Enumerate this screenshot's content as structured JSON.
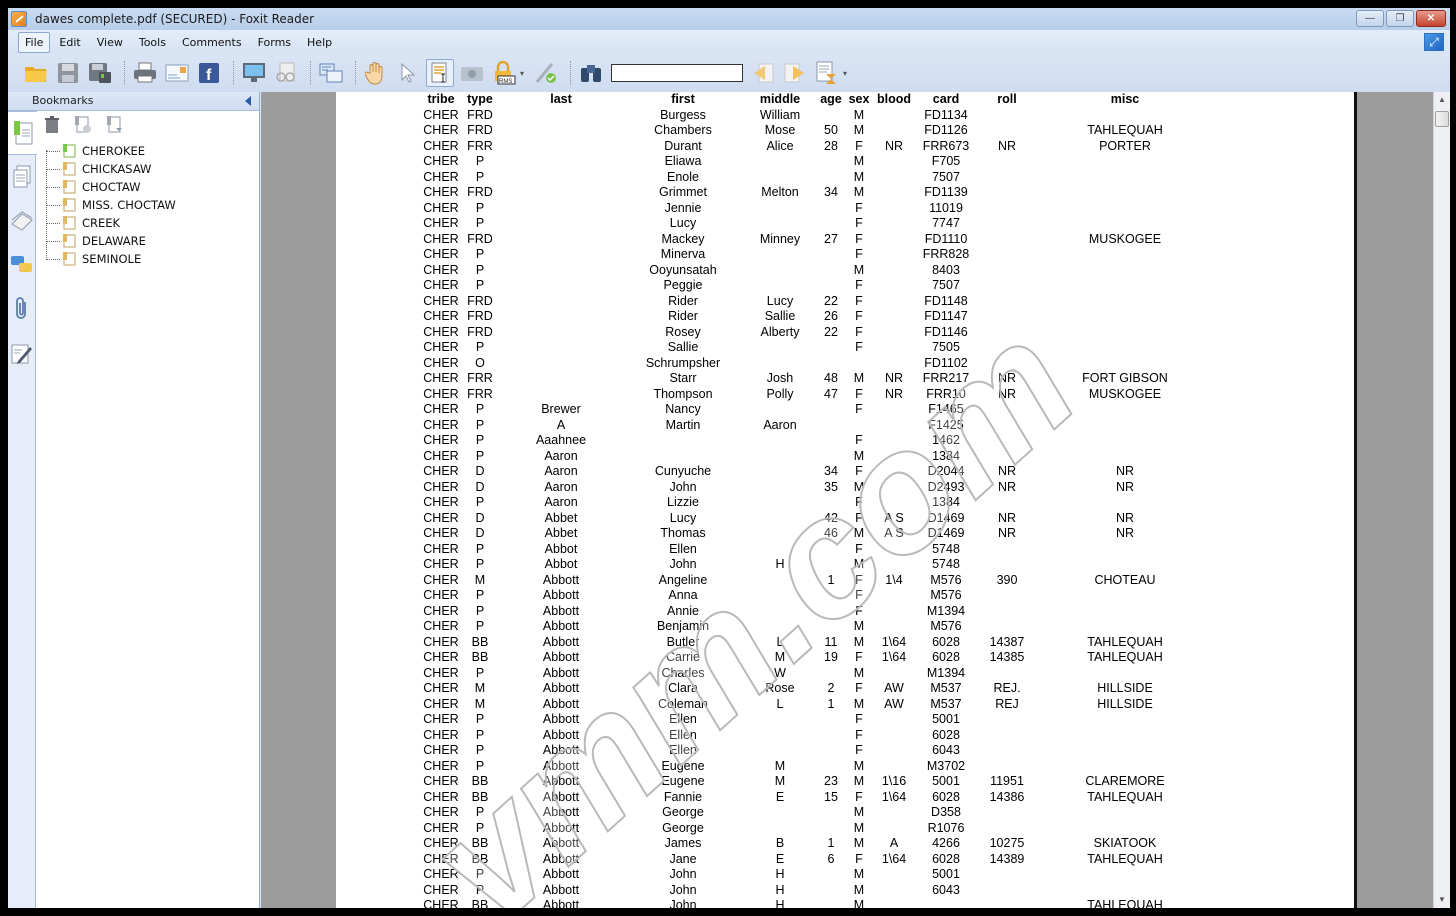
{
  "window": {
    "title": "dawes complete.pdf (SECURED) - Foxit Reader",
    "controls": {
      "minimize": "—",
      "restore": "❐",
      "close": "✕"
    }
  },
  "menu": [
    {
      "label": "File",
      "active": true
    },
    {
      "label": "Edit"
    },
    {
      "label": "View"
    },
    {
      "label": "Tools"
    },
    {
      "label": "Comments"
    },
    {
      "label": "Forms"
    },
    {
      "label": "Help"
    }
  ],
  "toolbar": {
    "icons": [
      "open-folder-icon",
      "save-icon",
      "save-as-icon",
      "print-icon",
      "email-icon",
      "facebook-icon",
      "presentation-icon",
      "reading-glasses-icon",
      "convert-icon",
      "hand-tool-icon",
      "select-arrow-icon",
      "select-text-icon",
      "snapshot-icon",
      "rms-lock-icon",
      "sign-icon",
      "find-binoculars-icon"
    ],
    "find_value": "",
    "find_prev_icon": "find-previous-icon",
    "find_next_icon": "find-next-icon",
    "filter_icon": "search-filter-icon"
  },
  "bookmarks": {
    "title": "Bookmarks",
    "items": [
      {
        "label": "CHEROKEE",
        "active": true
      },
      {
        "label": "CHICKASAW"
      },
      {
        "label": "CHOCTAW"
      },
      {
        "label": "MISS. CHOCTAW"
      },
      {
        "label": "CREEK"
      },
      {
        "label": "DELAWARE"
      },
      {
        "label": "SEMINOLE"
      }
    ]
  },
  "document": {
    "columns": [
      "tribe",
      "type",
      "last",
      "first",
      "middle",
      "age",
      "sex",
      "blood",
      "card",
      "roll",
      "misc"
    ],
    "rows": [
      [
        "CHER",
        "FRD",
        "",
        "Burgess",
        "William",
        "",
        "M",
        "",
        "FD1134",
        "",
        ""
      ],
      [
        "CHER",
        "FRD",
        "",
        "Chambers",
        "Mose",
        "50",
        "M",
        "",
        "FD1126",
        "",
        "TAHLEQUAH"
      ],
      [
        "CHER",
        "FRR",
        "",
        "Durant",
        "Alice",
        "28",
        "F",
        "NR",
        "FRR673",
        "NR",
        "PORTER"
      ],
      [
        "CHER",
        "P",
        "",
        "Eliawa",
        "",
        "",
        "M",
        "",
        "F705",
        "",
        ""
      ],
      [
        "CHER",
        "P",
        "",
        "Enole",
        "",
        "",
        "M",
        "",
        "7507",
        "",
        ""
      ],
      [
        "CHER",
        "FRD",
        "",
        "Grimmet",
        "Melton",
        "34",
        "M",
        "",
        "FD1139",
        "",
        ""
      ],
      [
        "CHER",
        "P",
        "",
        "Jennie",
        "",
        "",
        "F",
        "",
        "11019",
        "",
        ""
      ],
      [
        "CHER",
        "P",
        "",
        "Lucy",
        "",
        "",
        "F",
        "",
        "7747",
        "",
        ""
      ],
      [
        "CHER",
        "FRD",
        "",
        "Mackey",
        "Minney",
        "27",
        "F",
        "",
        "FD1110",
        "",
        "MUSKOGEE"
      ],
      [
        "CHER",
        "P",
        "",
        "Minerva",
        "",
        "",
        "F",
        "",
        "FRR828",
        "",
        ""
      ],
      [
        "CHER",
        "P",
        "",
        "Ooyunsatah",
        "",
        "",
        "M",
        "",
        "8403",
        "",
        ""
      ],
      [
        "CHER",
        "P",
        "",
        "Peggie",
        "",
        "",
        "F",
        "",
        "7507",
        "",
        ""
      ],
      [
        "CHER",
        "FRD",
        "",
        "Rider",
        "Lucy",
        "22",
        "F",
        "",
        "FD1148",
        "",
        ""
      ],
      [
        "CHER",
        "FRD",
        "",
        "Rider",
        "Sallie",
        "26",
        "F",
        "",
        "FD1147",
        "",
        ""
      ],
      [
        "CHER",
        "FRD",
        "",
        "Rosey",
        "Alberty",
        "22",
        "F",
        "",
        "FD1146",
        "",
        ""
      ],
      [
        "CHER",
        "P",
        "",
        "Sallie",
        "",
        "",
        "F",
        "",
        "7505",
        "",
        ""
      ],
      [
        "CHER",
        "O",
        "",
        "Schrumpsher",
        "",
        "",
        "",
        "",
        "FD1102",
        "",
        ""
      ],
      [
        "CHER",
        "FRR",
        "",
        "Starr",
        "Josh",
        "48",
        "M",
        "NR",
        "FRR217",
        "NR",
        "FORT GIBSON"
      ],
      [
        "CHER",
        "FRR",
        "",
        "Thompson",
        "Polly",
        "47",
        "F",
        "NR",
        "FRR10",
        "NR",
        "MUSKOGEE"
      ],
      [
        "CHER",
        "P",
        "Brewer",
        "Nancy",
        "",
        "",
        "F",
        "",
        "F1465",
        "",
        ""
      ],
      [
        "CHER",
        "P",
        "A",
        "Martin",
        "Aaron",
        "",
        "",
        "",
        "F1425",
        "",
        ""
      ],
      [
        "CHER",
        "P",
        "Aaahnee",
        "",
        "",
        "",
        "F",
        "",
        "1462",
        "",
        ""
      ],
      [
        "CHER",
        "P",
        "Aaron",
        "",
        "",
        "",
        "M",
        "",
        "1384",
        "",
        ""
      ],
      [
        "CHER",
        "D",
        "Aaron",
        "Cunyuche",
        "",
        "34",
        "F",
        "",
        "D2044",
        "NR",
        "NR"
      ],
      [
        "CHER",
        "D",
        "Aaron",
        "John",
        "",
        "35",
        "M",
        "",
        "D2493",
        "NR",
        "NR"
      ],
      [
        "CHER",
        "P",
        "Aaron",
        "Lizzie",
        "",
        "",
        "F",
        "",
        "1384",
        "",
        ""
      ],
      [
        "CHER",
        "D",
        "Abbet",
        "Lucy",
        "",
        "42",
        "F",
        "A S",
        "D1469",
        "NR",
        "NR"
      ],
      [
        "CHER",
        "D",
        "Abbet",
        "Thomas",
        "",
        "46",
        "M",
        "A S",
        "D1469",
        "NR",
        "NR"
      ],
      [
        "CHER",
        "P",
        "Abbot",
        "Ellen",
        "",
        "",
        "F",
        "",
        "5748",
        "",
        ""
      ],
      [
        "CHER",
        "P",
        "Abbot",
        "John",
        "H",
        "",
        "M",
        "",
        "5748",
        "",
        ""
      ],
      [
        "CHER",
        "M",
        "Abbott",
        "Angeline",
        "",
        "1",
        "F",
        "1\\4",
        "M576",
        "390",
        "CHOTEAU"
      ],
      [
        "CHER",
        "P",
        "Abbott",
        "Anna",
        "",
        "",
        "F",
        "",
        "M576",
        "",
        ""
      ],
      [
        "CHER",
        "P",
        "Abbott",
        "Annie",
        "",
        "",
        "F",
        "",
        "M1394",
        "",
        ""
      ],
      [
        "CHER",
        "P",
        "Abbott",
        "Benjamin",
        "",
        "",
        "M",
        "",
        "M576",
        "",
        ""
      ],
      [
        "CHER",
        "BB",
        "Abbott",
        "Butler",
        "L",
        "11",
        "M",
        "1\\64",
        "6028",
        "14387",
        "TAHLEQUAH"
      ],
      [
        "CHER",
        "BB",
        "Abbott",
        "Carrie",
        "M",
        "19",
        "F",
        "1\\64",
        "6028",
        "14385",
        "TAHLEQUAH"
      ],
      [
        "CHER",
        "P",
        "Abbott",
        "Charles",
        "W",
        "",
        "M",
        "",
        "M1394",
        "",
        ""
      ],
      [
        "CHER",
        "M",
        "Abbott",
        "Clara",
        "Rose",
        "2",
        "F",
        "AW",
        "M537",
        "REJ.",
        "HILLSIDE"
      ],
      [
        "CHER",
        "M",
        "Abbott",
        "Coleman",
        "L",
        "1",
        "M",
        "AW",
        "M537",
        "REJ",
        "HILLSIDE"
      ],
      [
        "CHER",
        "P",
        "Abbott",
        "Ellen",
        "",
        "",
        "F",
        "",
        "5001",
        "",
        ""
      ],
      [
        "CHER",
        "P",
        "Abbott",
        "Ellen",
        "",
        "",
        "F",
        "",
        "6028",
        "",
        ""
      ],
      [
        "CHER",
        "P",
        "Abbott",
        "Ellen",
        "",
        "",
        "F",
        "",
        "6043",
        "",
        ""
      ],
      [
        "CHER",
        "P",
        "Abbott",
        "Eugene",
        "M",
        "",
        "M",
        "",
        "M3702",
        "",
        ""
      ],
      [
        "CHER",
        "BB",
        "Abbott",
        "Eugene",
        "M",
        "23",
        "M",
        "1\\16",
        "5001",
        "11951",
        "CLAREMORE"
      ],
      [
        "CHER",
        "BB",
        "Abbott",
        "Fannie",
        "E",
        "15",
        "F",
        "1\\64",
        "6028",
        "14386",
        "TAHLEQUAH"
      ],
      [
        "CHER",
        "P",
        "Abbott",
        "George",
        "",
        "",
        "M",
        "",
        "D358",
        "",
        ""
      ],
      [
        "CHER",
        "P",
        "Abbott",
        "George",
        "",
        "",
        "M",
        "",
        "R1076",
        "",
        ""
      ],
      [
        "CHER",
        "BB",
        "Abbott",
        "James",
        "B",
        "1",
        "M",
        "A",
        "4266",
        "10275",
        "SKIATOOK"
      ],
      [
        "CHER",
        "BB",
        "Abbott",
        "Jane",
        "E",
        "6",
        "F",
        "1\\64",
        "6028",
        "14389",
        "TAHLEQUAH"
      ],
      [
        "CHER",
        "P",
        "Abbott",
        "John",
        "H",
        "",
        "M",
        "",
        "5001",
        "",
        ""
      ],
      [
        "CHER",
        "P",
        "Abbott",
        "John",
        "H",
        "",
        "M",
        "",
        "6043",
        "",
        ""
      ],
      [
        "CHER",
        "BB",
        "Abbott",
        "John",
        "H",
        "",
        "M",
        "",
        "",
        "",
        "TAHLEQUAH"
      ]
    ],
    "watermark": "vmm.com"
  }
}
